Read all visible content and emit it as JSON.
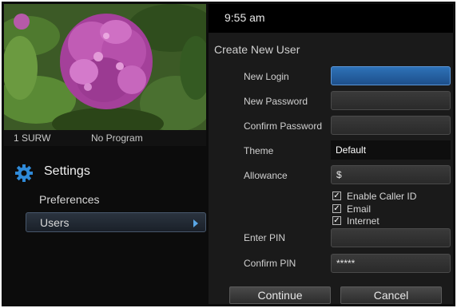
{
  "status": {
    "time": "9:55 am"
  },
  "tv": {
    "channel": "1 SURW",
    "program": "No Program"
  },
  "settings": {
    "title": "Settings",
    "menu": [
      {
        "label": "Preferences"
      },
      {
        "label": "Users"
      }
    ]
  },
  "form": {
    "title": "Create New User",
    "new_login_label": "New Login",
    "new_login_value": "",
    "new_password_label": "New Password",
    "new_password_value": "",
    "confirm_password_label": "Confirm Password",
    "confirm_password_value": "",
    "theme_label": "Theme",
    "theme_value": "Default",
    "allowance_label": "Allowance",
    "allowance_value": "$",
    "checkboxes": [
      {
        "label": "Enable Caller ID",
        "checked": true
      },
      {
        "label": "Email",
        "checked": true
      },
      {
        "label": "Internet",
        "checked": true
      }
    ],
    "enter_pin_label": "Enter PIN",
    "enter_pin_value": "",
    "confirm_pin_label": "Confirm PIN",
    "confirm_pin_value": "*****",
    "continue_label": "Continue",
    "cancel_label": "Cancel"
  },
  "colors": {
    "accent": "#2e72b8",
    "selected_arrow": "#5aa7e6",
    "background": "#0c0c0c"
  }
}
